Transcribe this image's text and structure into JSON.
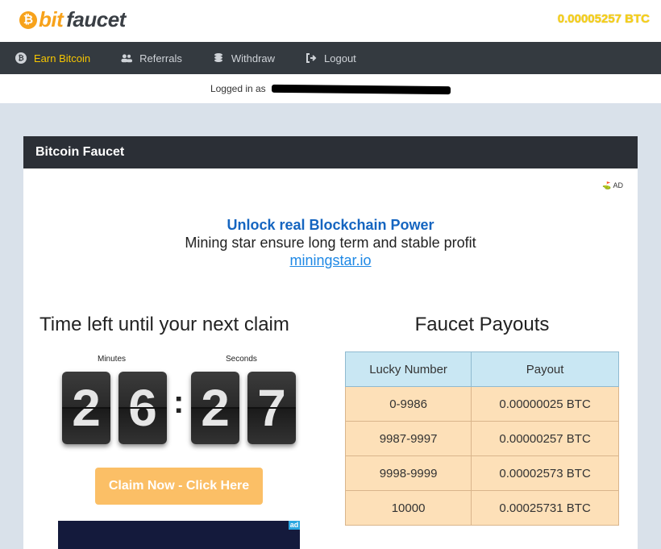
{
  "header": {
    "logo_coin": "₿",
    "logo_bit": "bit",
    "logo_faucet": "faucet",
    "balance": "0.00005257 BTC"
  },
  "nav": {
    "items": [
      {
        "label": "Earn Bitcoin",
        "icon": "bitcoin-icon",
        "glyph": "₿"
      },
      {
        "label": "Referrals",
        "icon": "users-icon",
        "glyph": "👥"
      },
      {
        "label": "Withdraw",
        "icon": "coins-icon",
        "glyph": "🪙"
      },
      {
        "label": "Logout",
        "icon": "sign-out-icon",
        "glyph": "➜"
      }
    ]
  },
  "logged_in": {
    "prefix": "Logged in as"
  },
  "card": {
    "title": "Bitcoin Faucet",
    "ad_tag": "AD"
  },
  "promo": {
    "title": "Unlock real Blockchain Power",
    "subtitle": "Mining star ensure long term and stable profit",
    "link": "miningstar.io"
  },
  "timer": {
    "title": "Time left until your next claim",
    "minutes_label": "Minutes",
    "seconds_label": "Seconds",
    "digits": [
      "2",
      "6",
      "2",
      "7"
    ],
    "separator": ":"
  },
  "claim_button": "Claim Now - Click Here",
  "banner_badge": "ad",
  "payouts": {
    "title": "Faucet Payouts",
    "headers": [
      "Lucky Number",
      "Payout"
    ],
    "rows": [
      [
        "0-9986",
        "0.00000025 BTC"
      ],
      [
        "9987-9997",
        "0.00000257 BTC"
      ],
      [
        "9998-9999",
        "0.00002573 BTC"
      ],
      [
        "10000",
        "0.00025731 BTC"
      ]
    ]
  },
  "colors": {
    "accent": "#f7a21b",
    "nav_bg": "#343a40",
    "nav_active": "#f7c600",
    "claim_button": "#fbbf66",
    "table_header": "#c9e7f3",
    "table_cell": "#fde0b8"
  }
}
